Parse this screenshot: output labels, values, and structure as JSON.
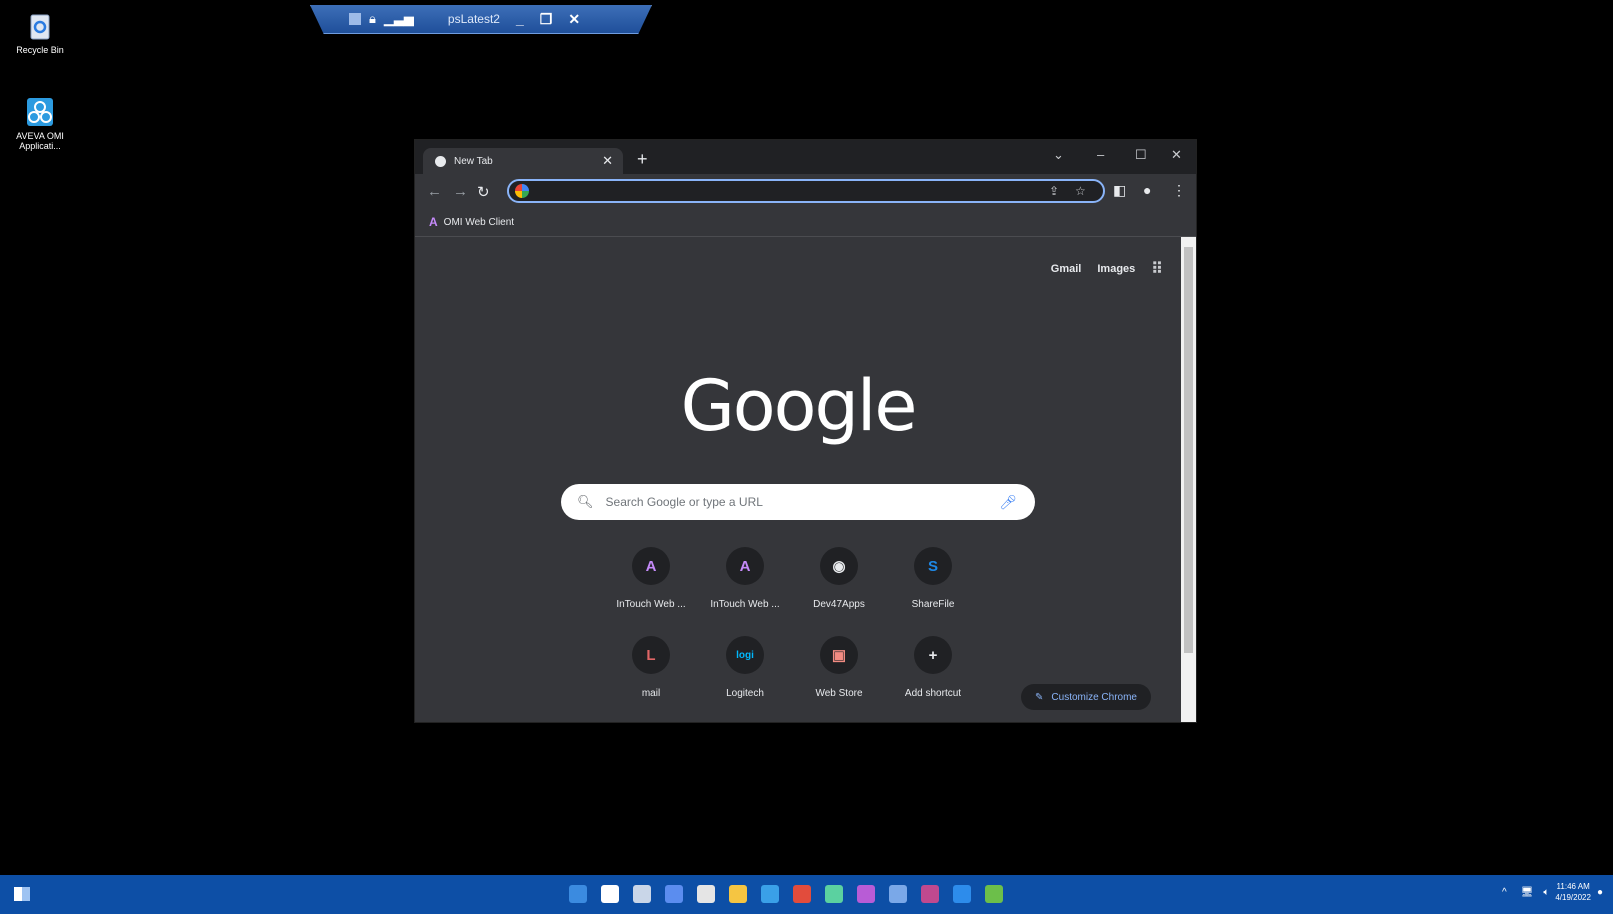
{
  "desktop": {
    "icons": [
      {
        "label": "Recycle Bin"
      },
      {
        "label": "AVEVA OMI Applicati..."
      }
    ]
  },
  "rdp_bar": {
    "title": "psLatest2"
  },
  "chrome": {
    "tab_title": "New Tab",
    "omnibox_value": "",
    "bookmark": "OMI Web Client",
    "ntp": {
      "links": [
        "Gmail",
        "Images"
      ],
      "logo": "Google",
      "search_placeholder": "Search Google or type a URL",
      "shortcuts": [
        {
          "label": "InTouch Web ...",
          "icon": "A",
          "color": "#c58af9"
        },
        {
          "label": "InTouch Web ...",
          "icon": "A",
          "color": "#c58af9"
        },
        {
          "label": "Dev47Apps",
          "icon": "◉",
          "color": "#e8eaed"
        },
        {
          "label": "ShareFile",
          "icon": "S",
          "color": "#1e88e5"
        },
        {
          "label": "mail",
          "icon": "L",
          "color": "#e06666"
        },
        {
          "label": "Logitech",
          "icon": "logi",
          "color": "#00b8fc"
        },
        {
          "label": "Web Store",
          "icon": "▣",
          "color": "#f28b82"
        },
        {
          "label": "Add shortcut",
          "icon": "+",
          "color": "#e8eaed"
        }
      ],
      "customize_label": "Customize Chrome"
    }
  },
  "taskbar": {
    "time": "11:46 AM",
    "date": "4/19/2022",
    "app_colors": [
      "#3b8be0",
      "#ffffff",
      "#c9d6e8",
      "#5b8def",
      "#e5e5e5",
      "#f5c542",
      "#3aa0e8",
      "#e24c3c",
      "#5bd1a0",
      "#b85cd6",
      "#7aa8e8",
      "#c0498f",
      "#2d8ceb",
      "#6cbf4a"
    ]
  }
}
